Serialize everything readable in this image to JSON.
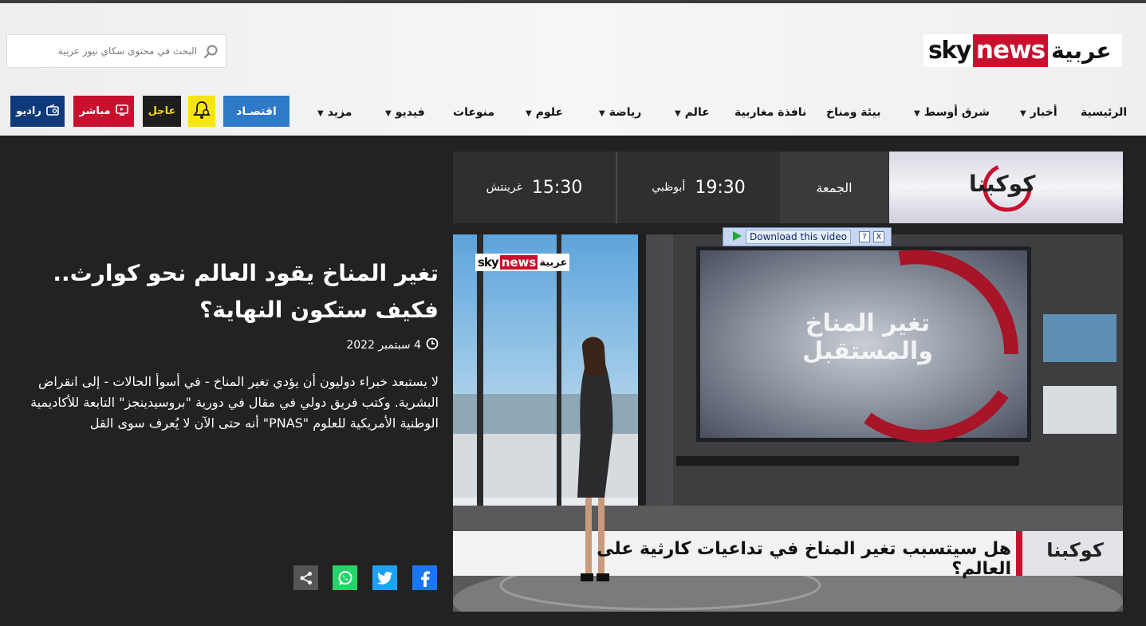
{
  "header": {
    "logo": {
      "sky": "sky",
      "news": "news",
      "arabic": "عربية"
    },
    "search": {
      "placeholder": "البحث في محتوى سكاي نيوز عربية"
    }
  },
  "nav": {
    "items": [
      {
        "label": "الرئيسية",
        "dropdown": false
      },
      {
        "label": "أخبار",
        "dropdown": true
      },
      {
        "label": "شرق أوسط",
        "dropdown": true
      },
      {
        "label": "بيئة ومناخ",
        "dropdown": false
      },
      {
        "label": "نافذة مغاربية",
        "dropdown": false
      },
      {
        "label": "عالم",
        "dropdown": true
      },
      {
        "label": "رياضة",
        "dropdown": true
      },
      {
        "label": "علوم",
        "dropdown": true
      },
      {
        "label": "منوعات",
        "dropdown": false
      },
      {
        "label": "فيديو",
        "dropdown": true
      },
      {
        "label": "مزيد",
        "dropdown": true
      }
    ],
    "buttons": {
      "economy": "اقتصـاد",
      "urgent": "عاجل",
      "live": "مباشر",
      "radio": "راديو"
    },
    "icons": {
      "alerts": "bell-gear-icon",
      "live": "tv-icon",
      "radio": "radio-icon"
    }
  },
  "schedule": {
    "show_name": "كوكبنا",
    "day": "الجمعة",
    "slots": [
      {
        "time": "19:30",
        "zone": "أبوظبي"
      },
      {
        "time": "15:30",
        "zone": "غرينتش"
      }
    ]
  },
  "article": {
    "headline_line1": "تغير المناخ يقود العالم نحو كوارث..",
    "headline_line2": "فكيف ستكون النهاية؟",
    "date": "4 سبتمبر 2022",
    "summary": "لا يستبعد خبراء دوليون أن يؤدي تغير المناخ - في أسوأ الحالات - إلى انقراض البشرية. وكتب فريق دولي في مقال في دورية \"بروسيدينجز\" التابعة للأكاديمية الوطنية الأمريكية للعلوم \"PNAS\" أنه حتى الآن لا يُعرف سوى القل"
  },
  "share": [
    "facebook-icon",
    "twitter-icon",
    "whatsapp-icon",
    "share-icon"
  ],
  "video": {
    "download_label": "Download this video",
    "help": "?",
    "close": "X",
    "logo_sky": "sky",
    "logo_news": "news",
    "logo_ar": "عربية",
    "screen_title": "تغير المناخ والمستقبل",
    "lower_third": "هل سيتسبب تغير المناخ في تداعيات كارثية على العالم؟",
    "show_name": "كوكبنا"
  },
  "colors": {
    "brand_red": "#c8102e",
    "economy_blue": "#2e79c8",
    "alert_yellow": "#f7e511",
    "radio_navy": "#0e3a7b",
    "background": "#222222"
  }
}
